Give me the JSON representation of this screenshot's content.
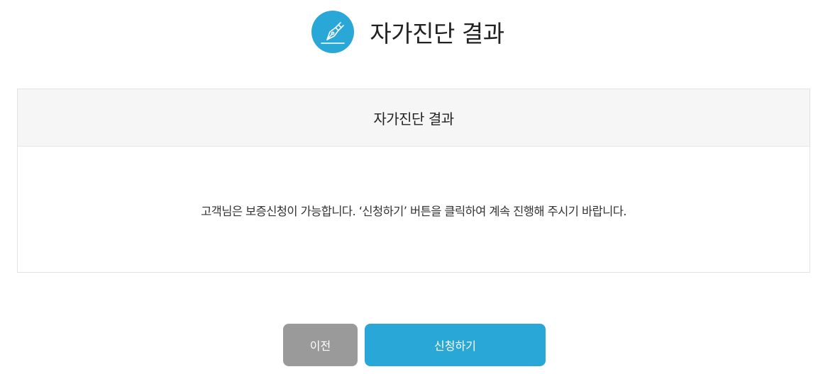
{
  "header": {
    "title": "자가진단 결과",
    "icon": "pen-nib-icon",
    "accent_color": "#29a8d8"
  },
  "panel": {
    "title": "자가진단 결과",
    "message": "고객님은 보증신청이 가능합니다. ‘신청하기’ 버튼을 클릭하여 계속 진행해 주시기 바랍니다."
  },
  "actions": {
    "prev_label": "이전",
    "prev_color": "#9a9a9a",
    "apply_label": "신청하기",
    "apply_color": "#29a8d8"
  }
}
